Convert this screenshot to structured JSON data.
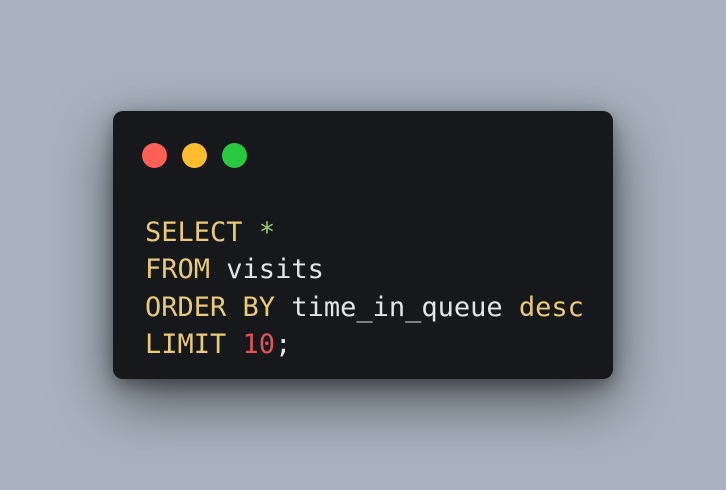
{
  "window": {
    "controls": [
      {
        "name": "close",
        "color": "#ff5f57"
      },
      {
        "name": "minimize",
        "color": "#febc2e"
      },
      {
        "name": "maximize",
        "color": "#28c840"
      }
    ]
  },
  "code": {
    "line1": {
      "kw": "SELECT",
      "op": "*"
    },
    "line2": {
      "kw": "FROM",
      "id": "visits"
    },
    "line3": {
      "kw1": "ORDER BY",
      "id": "time_in_queue",
      "kw2": "desc"
    },
    "line4": {
      "kw": "LIMIT",
      "num": "10",
      "punct": ";"
    }
  },
  "colors": {
    "background": "#a8b3bf",
    "window": "#17181b",
    "keyword": "#e8ca78",
    "operator": "#9ccc76",
    "identifier": "#e3e5e8",
    "number": "#e0525c"
  }
}
